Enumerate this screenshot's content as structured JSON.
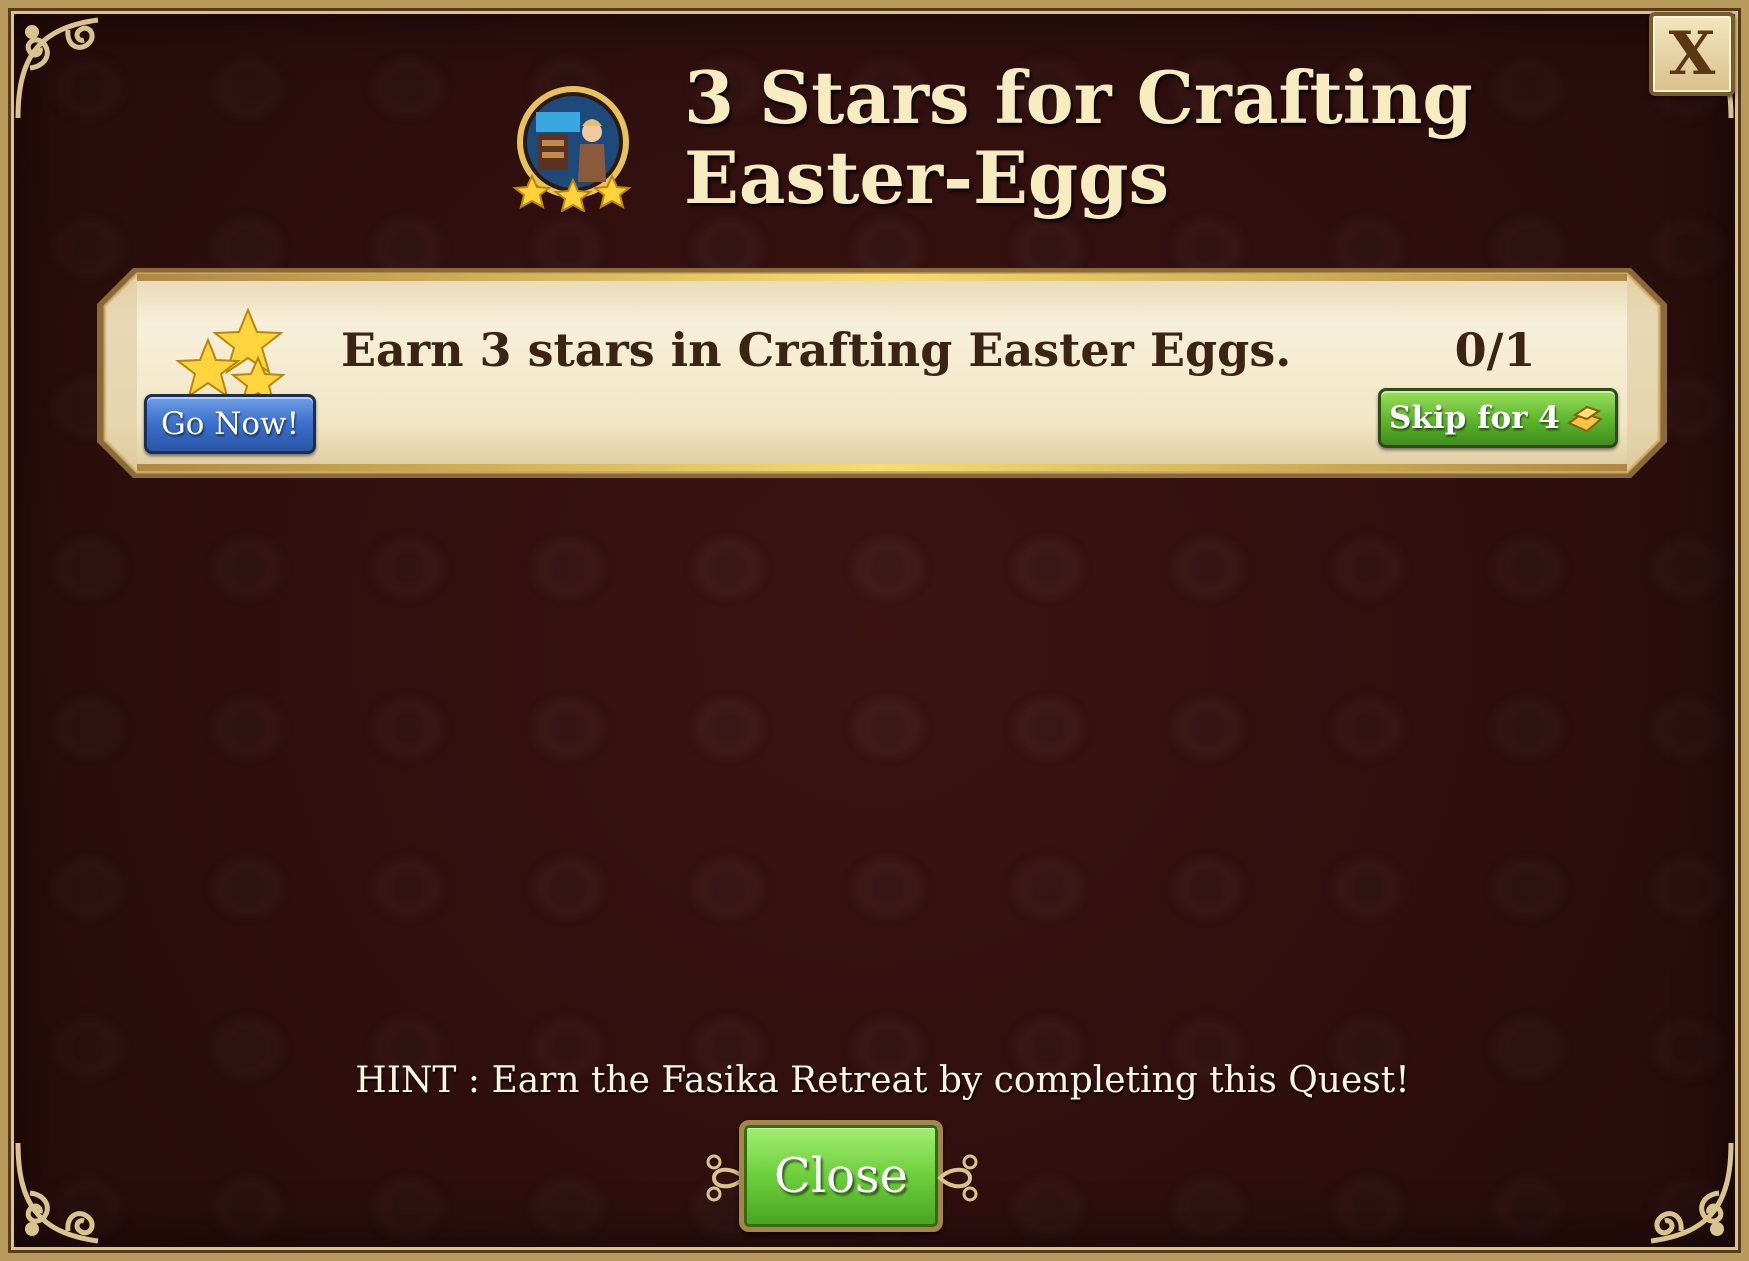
{
  "dialog": {
    "close_x_label": "X",
    "title_line1": "3 Stars for Crafting",
    "title_line2": "Easter-Eggs",
    "badge_icon": "crafting-quest-badge-icon"
  },
  "task": {
    "description": "Earn 3 stars in Crafting Easter Eggs.",
    "progress": "0/1",
    "go_now_label": "Go Now!",
    "skip_label": "Skip for 4",
    "skip_currency_icon": "gold-bar-icon",
    "stars_icon": "stars-icon"
  },
  "footer": {
    "hint": "HINT : Earn the Fasika Retreat by completing this Quest!",
    "close_label": "Close"
  },
  "colors": {
    "background": "#3b1412",
    "frame_gold": "#b89a5c",
    "title_text": "#f6ecc0",
    "panel_parchment": "#efe3c3",
    "go_now_blue": "#3b6fc9",
    "skip_green": "#5cb52b",
    "close_green": "#6ccf3a"
  }
}
